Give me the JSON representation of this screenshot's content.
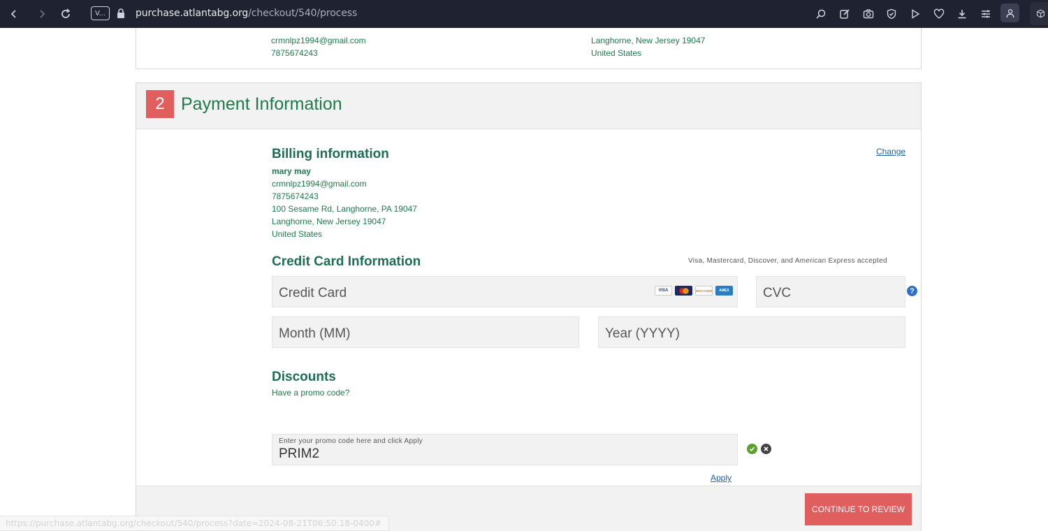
{
  "browser": {
    "tab_label": "V...",
    "url_host": "purchase.atlantabg.org",
    "url_path": "/checkout/540/process",
    "icons": [
      "back-icon",
      "forward-icon",
      "reload-icon",
      "lock-icon",
      "zoom-icon",
      "edit-icon",
      "camera-icon",
      "shield-icon",
      "play-icon",
      "heart-icon",
      "download-icon",
      "menu-icon",
      "profile-icon",
      "extension-icon"
    ]
  },
  "shipping": {
    "left": {
      "email": "crmnlpz1994@gmail.com",
      "phone": "7875674243"
    },
    "right": {
      "city_line": "Langhorne, New Jersey 19047",
      "country": "United States"
    }
  },
  "payment": {
    "step": "2",
    "title": "Payment Information",
    "billing": {
      "title": "Billing information",
      "change": "Change",
      "name": "mary may",
      "email": "crmnlpz1994@gmail.com",
      "phone": "7875674243",
      "address1": "100 Sesame Rd, Langhorne, PA 19047",
      "address2": "Langhorne, New Jersey 19047",
      "country": "United States"
    },
    "card": {
      "title": "Credit Card Information",
      "accepted": "Visa, Mastercard, Discover, and American Express accepted",
      "number_placeholder": "Credit Card",
      "cvc_placeholder": "CVC",
      "month_placeholder": "Month (MM)",
      "year_placeholder": "Year (YYYY)",
      "logos": [
        "VISA",
        "MC",
        "DISCOVER",
        "AMEX"
      ]
    },
    "discounts": {
      "title": "Discounts",
      "question": "Have a promo code?",
      "hint": "Enter your promo code here and click Apply",
      "value": "PRIM2",
      "apply": "Apply"
    },
    "continue": "CONTINUE TO REVIEW"
  },
  "status_url": "https://purchase.atlantabg.org/checkout/540/process?date=2024-08-21T06:50:18-0400#",
  "colors": {
    "accent_red": "#e15e5e",
    "text_green": "#1e7a4c",
    "link_blue": "#1f5fa8"
  }
}
